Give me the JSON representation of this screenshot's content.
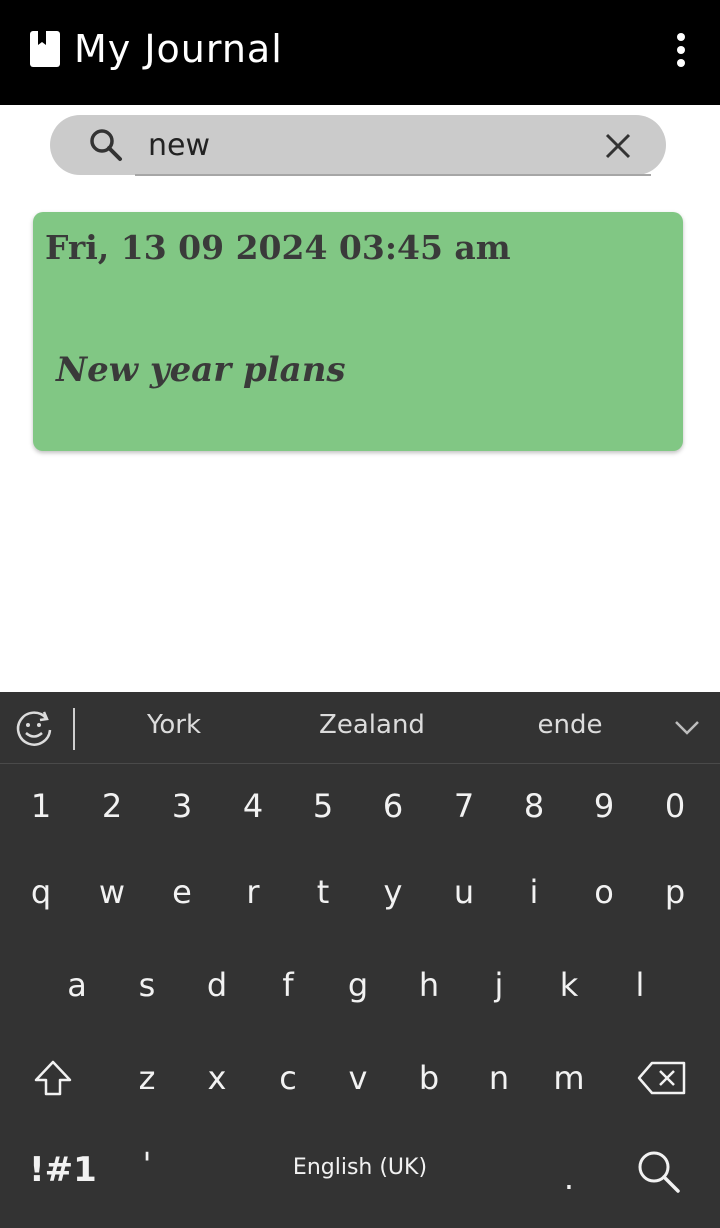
{
  "app_bar": {
    "title": "My Journal",
    "icon": "bookmark-icon",
    "menu_icon": "more-vert-icon"
  },
  "search": {
    "value": "new",
    "search_icon": "search-icon",
    "clear_icon": "close-icon"
  },
  "entries": [
    {
      "date": "Fri, 13 09 2024 03:45 am",
      "title": "New year plans",
      "color": "#81c784"
    }
  ],
  "keyboard": {
    "suggestions": [
      "York",
      "Zealand",
      "ende"
    ],
    "number_row": [
      "1",
      "2",
      "3",
      "4",
      "5",
      "6",
      "7",
      "8",
      "9",
      "0"
    ],
    "row1": [
      "q",
      "w",
      "e",
      "r",
      "t",
      "y",
      "u",
      "i",
      "o",
      "p"
    ],
    "row2": [
      "a",
      "s",
      "d",
      "f",
      "g",
      "h",
      "j",
      "k",
      "l"
    ],
    "row3": [
      "z",
      "x",
      "c",
      "v",
      "b",
      "n",
      "m"
    ],
    "symbols_label": "!#1",
    "apostrophe": "'",
    "space_label": "English (UK)",
    "period": "."
  },
  "colors": {
    "app_bar": "#000000",
    "search_bg": "#cbcbcb",
    "card_bg": "#81c784",
    "keyboard_bg": "#333333"
  }
}
